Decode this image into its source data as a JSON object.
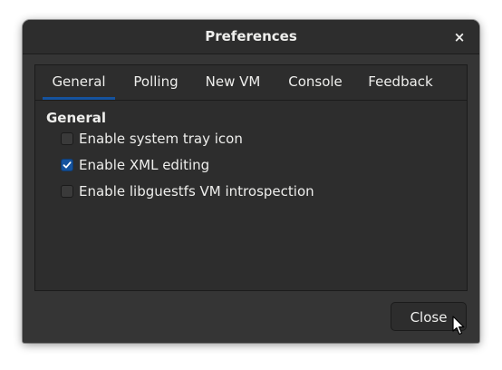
{
  "window": {
    "title": "Preferences",
    "close_glyph": "×"
  },
  "tabs": [
    {
      "label": "General",
      "active": true
    },
    {
      "label": "Polling",
      "active": false
    },
    {
      "label": "New VM",
      "active": false
    },
    {
      "label": "Console",
      "active": false
    },
    {
      "label": "Feedback",
      "active": false
    }
  ],
  "general": {
    "heading": "General",
    "options": [
      {
        "label": "Enable system tray icon",
        "checked": false
      },
      {
        "label": "Enable XML editing",
        "checked": true
      },
      {
        "label": "Enable libguestfs VM introspection",
        "checked": false
      }
    ]
  },
  "footer": {
    "close_label": "Close"
  },
  "colors": {
    "accent": "#15539e",
    "window_bg": "#353535",
    "text": "#eeeeec"
  },
  "icons": {
    "close": "close-icon",
    "check": "checkmark-icon",
    "pointer": "mouse-pointer-icon"
  }
}
